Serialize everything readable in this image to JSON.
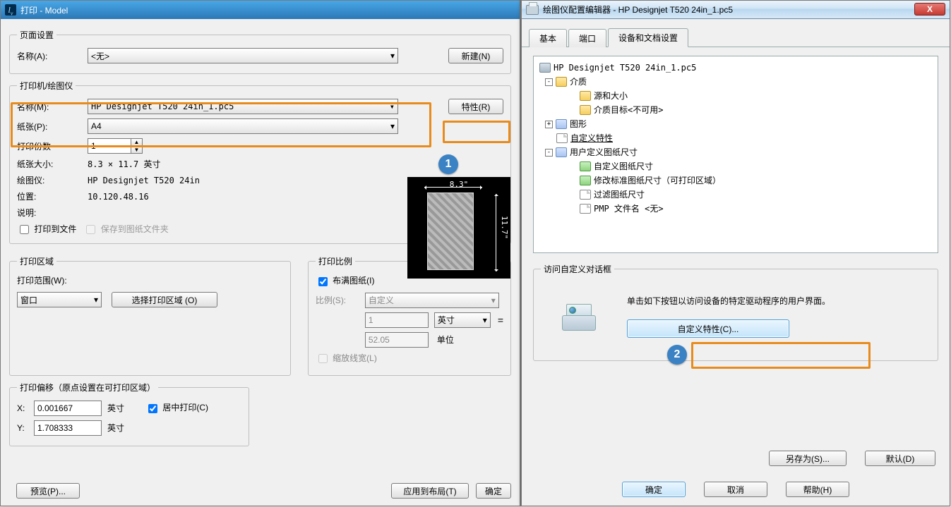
{
  "left_window": {
    "title": "打印 - Model",
    "page_setup": {
      "legend": "页面设置",
      "name_label": "名称(A):",
      "name_value": "<无>",
      "new_btn": "新建(N)"
    },
    "plotter": {
      "legend": "打印机/绘图仪",
      "name_label": "名称(M):",
      "name_value": "HP Designjet T520 24in_1.pc5",
      "props_btn": "特性(R)",
      "paper_label": "纸张(P):",
      "paper_value": "A4",
      "copies_label": "打印份数",
      "copies_value": "1",
      "size_label": "纸张大小:",
      "size_value": "8.3 × 11.7  英寸",
      "plotter_label": "绘图仪:",
      "plotter_value": "HP Designjet T520 24in",
      "location_label": "位置:",
      "location_value": "10.120.48.16",
      "desc_label": "说明:",
      "chk_tofile": "打印到文件",
      "chk_savetofolder": "保存到图纸文件夹",
      "preview_w": "8.3\"",
      "preview_h": "11.7\""
    },
    "area": {
      "legend": "打印区域",
      "range_label": "打印范围(W):",
      "range_value": "窗口",
      "pick_btn": "选择打印区域 (O)"
    },
    "scale": {
      "legend": "打印比例",
      "fit_chk": "布满图纸(I)",
      "ratio_label": "比例(S):",
      "ratio_value": "自定义",
      "num_value": "1",
      "unit_inch": "英寸",
      "equals": "=",
      "num2_value": "52.05",
      "unit_unit": "单位",
      "scale_line_chk": "缩放线宽(L)"
    },
    "offset": {
      "legend": "打印偏移（原点设置在可打印区域）",
      "x_label": "X:",
      "x_value": "0.001667",
      "y_label": "Y:",
      "y_value": "1.708333",
      "unit": "英寸",
      "center_chk": "居中打印(C)"
    },
    "footer": {
      "preview_btn": "预览(P)...",
      "apply_btn": "应用到布局(T)",
      "ok_btn": "确定"
    }
  },
  "right_window": {
    "title": "绘图仪配置编辑器 - HP Designjet T520 24in_1.pc5",
    "tabs": {
      "t1": "基本",
      "t2": "端口",
      "t3": "设备和文档设置"
    },
    "tree": {
      "root": "HP Designjet T520 24in_1.pc5",
      "media": "介质",
      "media_src": "源和大小",
      "media_dest": "介质目标<不可用>",
      "graphics": "图形",
      "custom_props": "自定义特性",
      "user_sizes": "用户定义图纸尺寸",
      "us_custom": "自定义图纸尺寸",
      "us_mod": "修改标准图纸尺寸（可打印区域）",
      "us_filter": "过滤图纸尺寸",
      "pmp": "PMP 文件名 <无>"
    },
    "access": {
      "legend": "访问自定义对话框",
      "hint": "单击如下按钮以访问设备的特定驱动程序的用户界面。",
      "btn": "自定义特性(C)..."
    },
    "bottom": {
      "saveas": "另存为(S)...",
      "default": "默认(D)"
    },
    "final": {
      "ok": "确定",
      "cancel": "取消",
      "help": "帮助(H)"
    }
  },
  "badges": {
    "one": "1",
    "two": "2"
  }
}
